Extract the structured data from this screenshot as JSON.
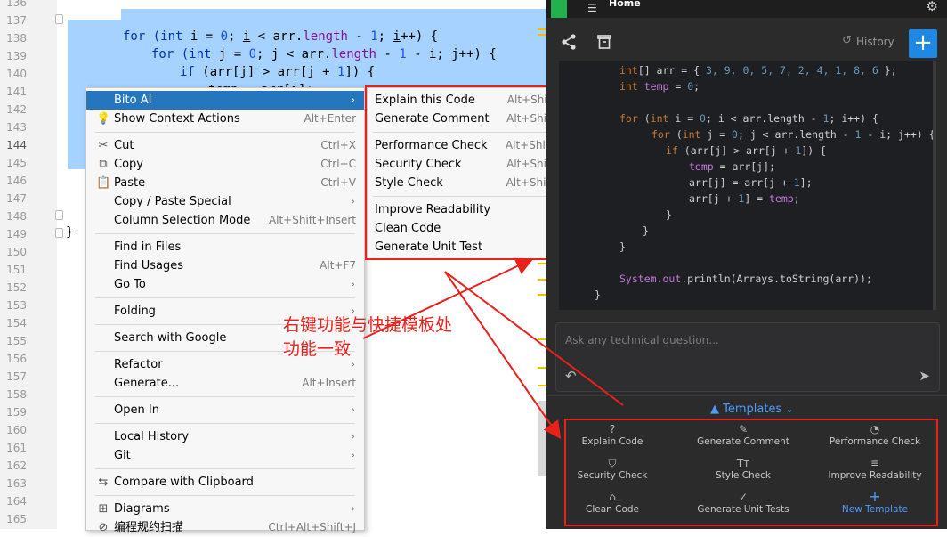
{
  "editor": {
    "line_numbers": [
      "136",
      "137",
      "138",
      "139",
      "140",
      "141",
      "142",
      "143",
      "144",
      "145",
      "146",
      "147",
      "148",
      "149",
      "150",
      "151",
      "152",
      "153",
      "154",
      "155",
      "156",
      "157",
      "158",
      "159",
      "160",
      "161",
      "162",
      "163",
      "164",
      "165"
    ],
    "code_lines": {
      "l137": [
        "for (",
        "int",
        " i = ",
        "0",
        "; ",
        "i",
        " < arr.",
        "length",
        " - ",
        "1",
        "; ",
        "i",
        "++) {"
      ],
      "l138": [
        "for (",
        "int",
        " j = ",
        "0",
        "; j < arr.",
        "length",
        " - ",
        "1",
        " - i; j++) {"
      ],
      "l139": [
        "if",
        " (arr[j] > arr[j + ",
        "1",
        "]) {"
      ],
      "l140": [
        "temp",
        " = arr[j];"
      ],
      "l149": "}"
    }
  },
  "context_menu": {
    "items": [
      {
        "label": "Bito AI",
        "shortcut": "",
        "submenu": true,
        "icon": ""
      },
      {
        "label": "Show Context Actions",
        "shortcut": "Alt+Enter",
        "submenu": false,
        "icon": "lightbulb-icon"
      },
      {
        "label": "Cut",
        "shortcut": "Ctrl+X",
        "submenu": false,
        "icon": "scissors-icon"
      },
      {
        "label": "Copy",
        "shortcut": "Ctrl+C",
        "submenu": false,
        "icon": "copy-icon"
      },
      {
        "label": "Paste",
        "shortcut": "Ctrl+V",
        "submenu": false,
        "icon": "clipboard-icon"
      },
      {
        "label": "Copy / Paste Special",
        "shortcut": "",
        "submenu": true,
        "icon": ""
      },
      {
        "label": "Column Selection Mode",
        "shortcut": "Alt+Shift+Insert",
        "submenu": false,
        "icon": ""
      },
      {
        "label": "Find in Files",
        "shortcut": "",
        "submenu": false,
        "icon": ""
      },
      {
        "label": "Find Usages",
        "shortcut": "Alt+F7",
        "submenu": false,
        "icon": ""
      },
      {
        "label": "Go To",
        "shortcut": "",
        "submenu": true,
        "icon": ""
      },
      {
        "label": "Folding",
        "shortcut": "",
        "submenu": true,
        "icon": ""
      },
      {
        "label": "Search with Google",
        "shortcut": "",
        "submenu": false,
        "icon": ""
      },
      {
        "label": "Refactor",
        "shortcut": "",
        "submenu": true,
        "icon": ""
      },
      {
        "label": "Generate...",
        "shortcut": "Alt+Insert",
        "submenu": false,
        "icon": ""
      },
      {
        "label": "Open In",
        "shortcut": "",
        "submenu": true,
        "icon": ""
      },
      {
        "label": "Local History",
        "shortcut": "",
        "submenu": true,
        "icon": ""
      },
      {
        "label": "Git",
        "shortcut": "",
        "submenu": true,
        "icon": ""
      },
      {
        "label": "Compare with Clipboard",
        "shortcut": "",
        "submenu": false,
        "icon": "compare-icon"
      },
      {
        "label": "Diagrams",
        "shortcut": "",
        "submenu": true,
        "icon": "diagram-icon"
      },
      {
        "label": "编程规约扫描",
        "shortcut": "Ctrl+Alt+Shift+J",
        "submenu": false,
        "icon": "scan-icon"
      }
    ]
  },
  "bito_submenu": {
    "items": [
      {
        "label": "Explain this Code",
        "shortcut": "Alt+Shift+E"
      },
      {
        "label": "Generate Comment",
        "shortcut": "Alt+Shift+V"
      },
      {
        "label": "Performance Check",
        "shortcut": "Alt+Shift+Q"
      },
      {
        "label": "Security Check",
        "shortcut": "Alt+Shift+Z"
      },
      {
        "label": "Style Check",
        "shortcut": "Alt+Shift+U"
      },
      {
        "label": "Improve Readability",
        "shortcut": ""
      },
      {
        "label": "Clean Code",
        "shortcut": ""
      },
      {
        "label": "Generate Unit Test",
        "shortcut": ""
      }
    ]
  },
  "annotation": {
    "line1": "右键功能与快捷模板处",
    "line2": "功能一致",
    "color": "#e8211c"
  },
  "panel": {
    "tab_title": "Home",
    "history_label": "History",
    "plus_label": "+",
    "ask_placeholder": "Ask any technical question...",
    "templates_label": "Templates",
    "code": {
      "l1": [
        "int",
        "[] arr = { ",
        "3, 9, 0, 5, 7, 2, 4, 1, 8, 6",
        " };"
      ],
      "l2": [
        "int",
        " ",
        "temp",
        " = ",
        "0",
        ";"
      ],
      "l3": [
        "for",
        " (",
        "int",
        " i = ",
        "0",
        "; i < arr.length - ",
        "1",
        "; i++) {"
      ],
      "l4": [
        "for",
        " (",
        "int",
        " j = ",
        "0",
        "; j < arr.length - ",
        "1",
        " - i; j++) {"
      ],
      "l5": [
        "if",
        " (arr[j] > arr[j + ",
        "1",
        "]) {"
      ],
      "l6": [
        "temp",
        " = arr[j];"
      ],
      "l7": [
        "arr[j] = arr[j + ",
        "1",
        "];"
      ],
      "l8": [
        "arr[j + ",
        "1",
        "] = ",
        "temp",
        ";"
      ],
      "l9": "}",
      "l10": "}",
      "l11": "}",
      "l12": [
        "System.",
        "out",
        ".println(Arrays.toString(arr));"
      ],
      "l13": "}"
    },
    "templates": [
      {
        "label": "Explain Code",
        "icon": "question-circle-icon",
        "glyph": "?"
      },
      {
        "label": "Generate Comment",
        "icon": "comment-icon",
        "glyph": "✎"
      },
      {
        "label": "Performance Check",
        "icon": "gauge-icon",
        "glyph": "◔"
      },
      {
        "label": "Security Check",
        "icon": "shield-icon",
        "glyph": "⛉"
      },
      {
        "label": "Style Check",
        "icon": "text-style-icon",
        "glyph": "Tт"
      },
      {
        "label": "Improve Readability",
        "icon": "readability-icon",
        "glyph": "≡"
      },
      {
        "label": "Clean Code",
        "icon": "broom-icon",
        "glyph": "⌂"
      },
      {
        "label": "Generate Unit Tests",
        "icon": "check-circle-icon",
        "glyph": "✓"
      },
      {
        "label": "New Template",
        "icon": "plus-icon",
        "glyph": "+"
      }
    ]
  },
  "colors": {
    "highlight_red": "#e8211c",
    "menu_active": "#2675bf",
    "accent_blue": "#1e88e5",
    "selection": "#a6d2ff"
  }
}
